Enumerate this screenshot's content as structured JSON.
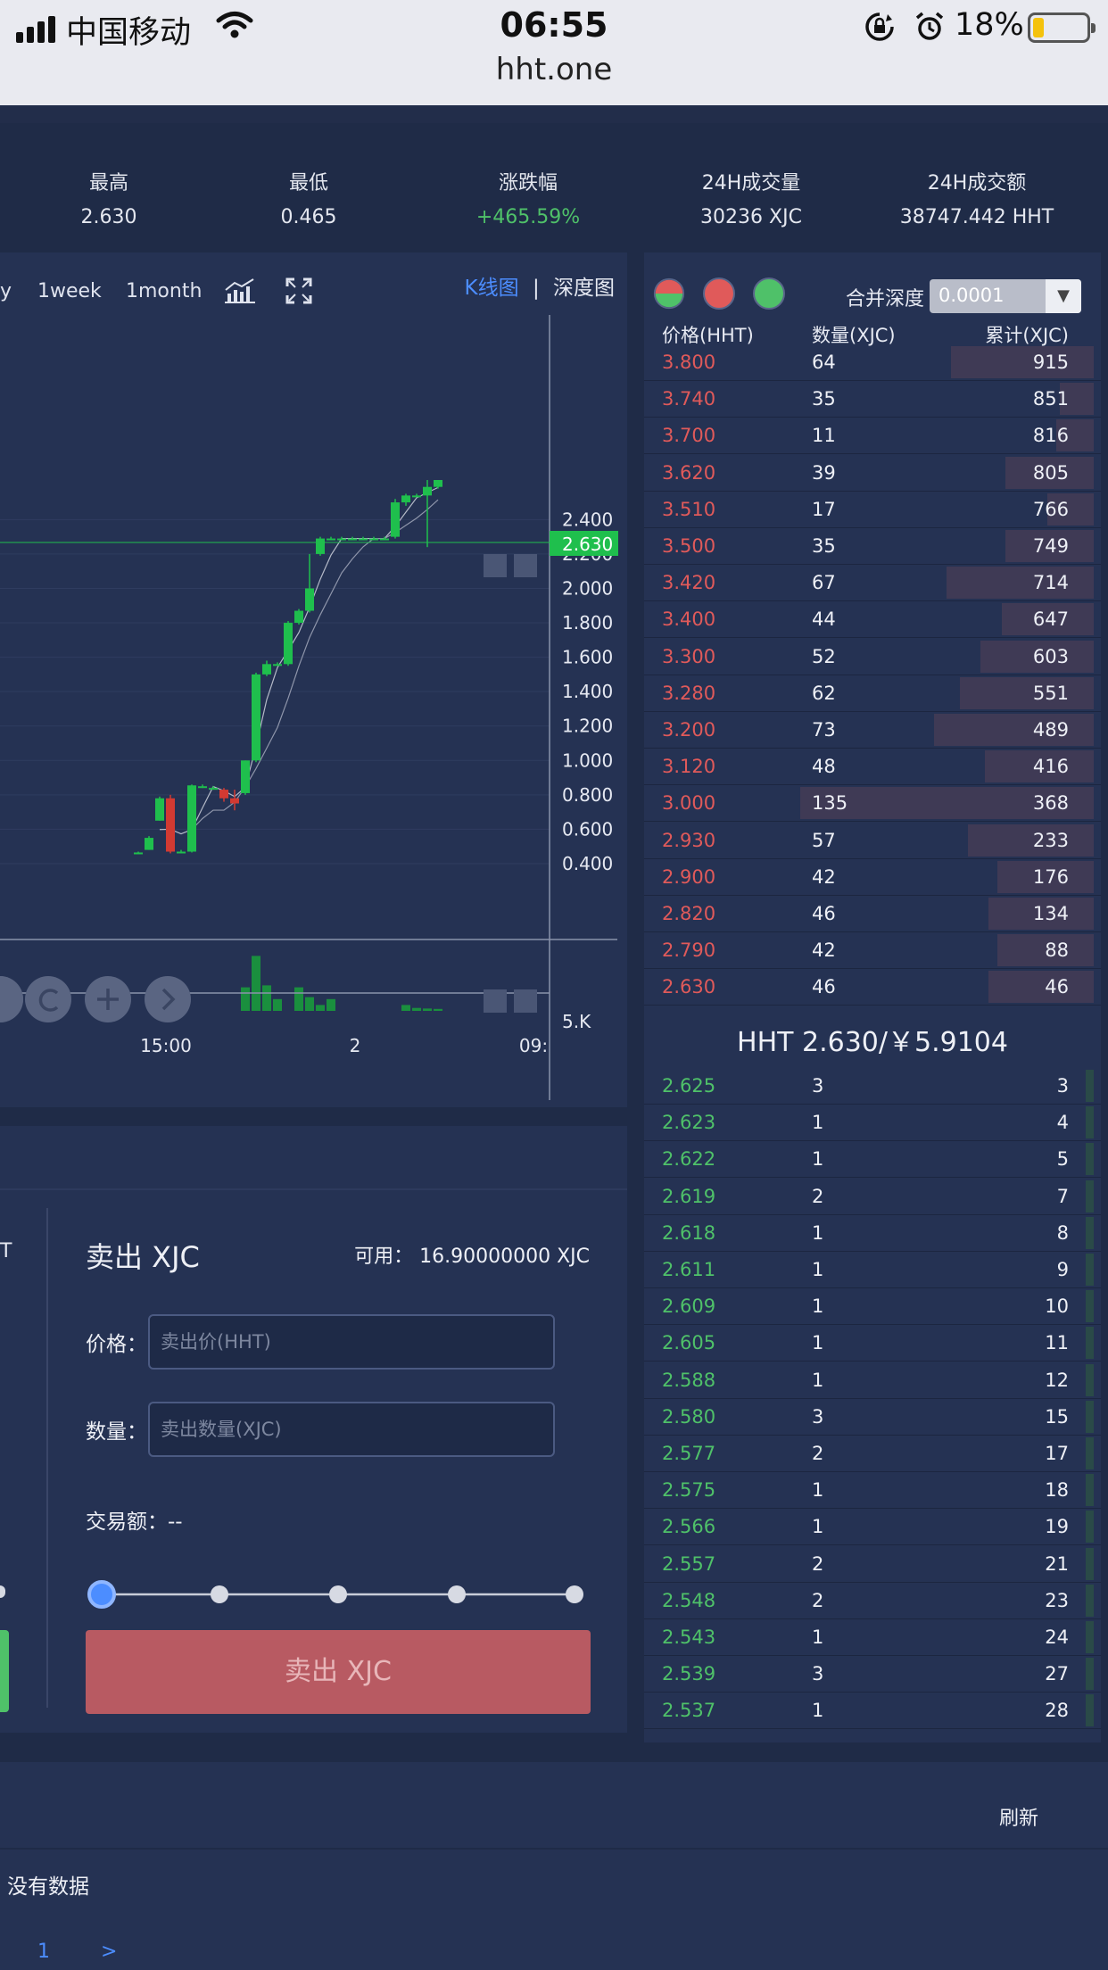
{
  "status_bar": {
    "carrier": "中国移动",
    "time": "06:55",
    "battery_percent": "18%",
    "url": "hht.one",
    "icons": [
      "signal-icon",
      "wifi-icon",
      "rotation-lock-icon",
      "alarm-icon",
      "battery-icon"
    ]
  },
  "stats": [
    {
      "label": "最高",
      "value": "2.630"
    },
    {
      "label": "最低",
      "value": "0.465"
    },
    {
      "label": "涨跌幅",
      "value": "+465.59%",
      "color": "#4fc169"
    },
    {
      "label": "24H成交量",
      "value": "30236 XJC"
    },
    {
      "label": "24H成交额",
      "value": "38747.442 HHT"
    }
  ],
  "chart_panel": {
    "periods": [
      "y",
      "1week",
      "1month"
    ],
    "tabs": {
      "kline": "K线图",
      "separator": "|",
      "depth": "深度图"
    },
    "current_price_tag": "2.630",
    "volume_label": "5.K",
    "icons": [
      "indicator-icon",
      "fullscreen-icon",
      "refresh-icon",
      "zoom-in-icon",
      "next-icon"
    ]
  },
  "chart_data": {
    "type": "candlestick",
    "y_tick_labels": [
      "2.400",
      "2.200",
      "2.000",
      "1.800",
      "1.600",
      "1.400",
      "1.200",
      "1.000",
      "0.800",
      "0.600",
      "0.400"
    ],
    "x_tick_labels": [
      "15:00",
      "2",
      "09:"
    ],
    "ylim": [
      0.4,
      2.63
    ],
    "colors": {
      "up": "#1fbf4d",
      "down": "#d23a32"
    },
    "candles": [
      {
        "o": 0.46,
        "h": 0.47,
        "l": 0.455,
        "c": 0.465
      },
      {
        "o": 0.48,
        "h": 0.56,
        "l": 0.48,
        "c": 0.55
      },
      {
        "o": 0.65,
        "h": 0.79,
        "l": 0.65,
        "c": 0.78
      },
      {
        "o": 0.78,
        "h": 0.8,
        "l": 0.46,
        "c": 0.47
      },
      {
        "o": 0.47,
        "h": 0.48,
        "l": 0.46,
        "c": 0.47
      },
      {
        "o": 0.47,
        "h": 0.86,
        "l": 0.465,
        "c": 0.855
      },
      {
        "o": 0.85,
        "h": 0.86,
        "l": 0.84,
        "c": 0.85
      },
      {
        "o": 0.84,
        "h": 0.85,
        "l": 0.83,
        "c": 0.84
      },
      {
        "o": 0.83,
        "h": 0.84,
        "l": 0.76,
        "c": 0.78
      },
      {
        "o": 0.78,
        "h": 0.83,
        "l": 0.71,
        "c": 0.75
      },
      {
        "o": 0.81,
        "h": 1.0,
        "l": 0.8,
        "c": 1.0
      },
      {
        "o": 1.0,
        "h": 1.51,
        "l": 0.99,
        "c": 1.5
      },
      {
        "o": 1.5,
        "h": 1.58,
        "l": 1.49,
        "c": 1.56
      },
      {
        "o": 1.56,
        "h": 1.57,
        "l": 1.55,
        "c": 1.56
      },
      {
        "o": 1.56,
        "h": 1.81,
        "l": 1.55,
        "c": 1.8
      },
      {
        "o": 1.8,
        "h": 1.88,
        "l": 1.79,
        "c": 1.87
      },
      {
        "o": 1.87,
        "h": 2.2,
        "l": 1.86,
        "c": 2.0
      },
      {
        "o": 2.2,
        "h": 2.3,
        "l": 2.19,
        "c": 2.29
      },
      {
        "o": 2.29,
        "h": 2.3,
        "l": 2.28,
        "c": 2.29
      },
      {
        "o": 2.29,
        "h": 2.3,
        "l": 2.28,
        "c": 2.29
      },
      {
        "o": 2.29,
        "h": 2.3,
        "l": 2.28,
        "c": 2.29
      },
      {
        "o": 2.29,
        "h": 2.3,
        "l": 2.28,
        "c": 2.29
      },
      {
        "o": 2.29,
        "h": 2.3,
        "l": 2.28,
        "c": 2.29
      },
      {
        "o": 2.29,
        "h": 2.3,
        "l": 2.28,
        "c": 2.29
      },
      {
        "o": 2.3,
        "h": 2.52,
        "l": 2.29,
        "c": 2.5
      },
      {
        "o": 2.5,
        "h": 2.55,
        "l": 2.48,
        "c": 2.54
      },
      {
        "o": 2.54,
        "h": 2.55,
        "l": 2.53,
        "c": 2.54
      },
      {
        "o": 2.54,
        "h": 2.63,
        "l": 2.24,
        "c": 2.59
      },
      {
        "o": 2.59,
        "h": 2.63,
        "l": 2.58,
        "c": 2.63
      }
    ],
    "volumes": [
      0,
      0,
      0,
      0,
      0,
      0,
      0,
      0,
      0,
      0,
      1200,
      2800,
      1300,
      600,
      0,
      1200,
      700,
      300,
      600,
      0,
      0,
      0,
      0,
      0,
      0,
      300,
      150,
      120,
      100
    ]
  },
  "orderbook": {
    "depth_label": "合并深度",
    "depth_value": "0.0001",
    "headers": [
      "价格(HHT)",
      "数量(XJC)",
      "累计(XJC)"
    ],
    "dot_colors": [
      "mixed",
      "#e05a5a",
      "#4fc169"
    ],
    "asks": [
      [
        "3.800",
        "64",
        "915"
      ],
      [
        "3.740",
        "35",
        "851"
      ],
      [
        "3.700",
        "11",
        "816"
      ],
      [
        "3.620",
        "39",
        "805"
      ],
      [
        "3.510",
        "17",
        "766"
      ],
      [
        "3.500",
        "35",
        "749"
      ],
      [
        "3.420",
        "67",
        "714"
      ],
      [
        "3.400",
        "44",
        "647"
      ],
      [
        "3.300",
        "52",
        "603"
      ],
      [
        "3.280",
        "62",
        "551"
      ],
      [
        "3.200",
        "73",
        "489"
      ],
      [
        "3.120",
        "48",
        "416"
      ],
      [
        "3.000",
        "135",
        "368"
      ],
      [
        "2.930",
        "57",
        "233"
      ],
      [
        "2.900",
        "42",
        "176"
      ],
      [
        "2.820",
        "46",
        "134"
      ],
      [
        "2.790",
        "42",
        "88"
      ],
      [
        "2.630",
        "46",
        "46"
      ]
    ],
    "ask_depth": [
      0.34,
      0.08,
      0.09,
      0.21,
      0.11,
      0.21,
      0.35,
      0.22,
      0.27,
      0.32,
      0.38,
      0.26,
      0.7,
      0.3,
      0.23,
      0.25,
      0.23,
      0.25
    ],
    "mid_price": "HHT 2.630/￥5.9104",
    "bids": [
      [
        "2.625",
        "3",
        "3"
      ],
      [
        "2.623",
        "1",
        "4"
      ],
      [
        "2.622",
        "1",
        "5"
      ],
      [
        "2.619",
        "2",
        "7"
      ],
      [
        "2.618",
        "1",
        "8"
      ],
      [
        "2.611",
        "1",
        "9"
      ],
      [
        "2.609",
        "1",
        "10"
      ],
      [
        "2.605",
        "1",
        "11"
      ],
      [
        "2.588",
        "1",
        "12"
      ],
      [
        "2.580",
        "3",
        "15"
      ],
      [
        "2.577",
        "2",
        "17"
      ],
      [
        "2.575",
        "1",
        "18"
      ],
      [
        "2.566",
        "1",
        "19"
      ],
      [
        "2.557",
        "2",
        "21"
      ],
      [
        "2.548",
        "2",
        "23"
      ],
      [
        "2.543",
        "1",
        "24"
      ],
      [
        "2.539",
        "3",
        "27"
      ],
      [
        "2.537",
        "1",
        "28"
      ]
    ],
    "bid_depth": [
      0.02,
      0.02,
      0.02,
      0.02,
      0.02,
      0.02,
      0.02,
      0.02,
      0.02,
      0.02,
      0.02,
      0.02,
      0.02,
      0.02,
      0.02,
      0.02,
      0.02,
      0.02
    ]
  },
  "sell_panel": {
    "title": "卖出  XJC",
    "available": "可用：  16.90000000 XJC",
    "left_fragment": "T",
    "price_label": "价格：",
    "price_placeholder": "卖出价(HHT)",
    "qty_label": "数量：",
    "qty_placeholder": "卖出数量(XJC)",
    "trade_label": "交易额：",
    "trade_value": "--",
    "slider_value": 0.0,
    "button": "卖出 XJC"
  },
  "bottom": {
    "refresh": "刷新",
    "no_data": "没有数据",
    "page": "1",
    "next": ">"
  }
}
